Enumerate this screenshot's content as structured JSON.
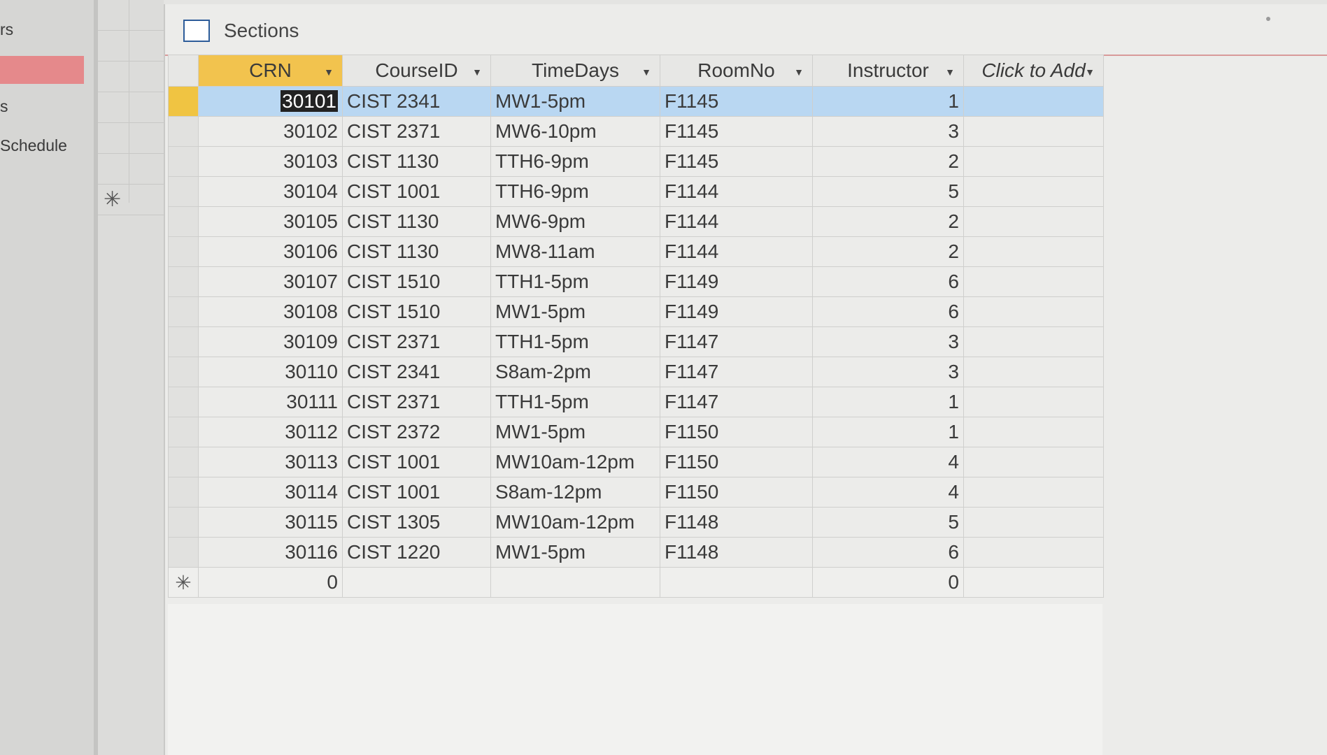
{
  "nav": {
    "items": [
      "rs",
      "",
      "s",
      "Schedule"
    ]
  },
  "window": {
    "title": "Sections"
  },
  "table": {
    "columns": [
      "CRN",
      "CourseID",
      "TimeDays",
      "RoomNo",
      "Instructor",
      "Click to Add"
    ],
    "rows": [
      {
        "crn": "30101",
        "course": "CIST 2341",
        "time": "MW1-5pm",
        "room": "F1145",
        "instructor": "1"
      },
      {
        "crn": "30102",
        "course": "CIST 2371",
        "time": "MW6-10pm",
        "room": "F1145",
        "instructor": "3"
      },
      {
        "crn": "30103",
        "course": "CIST 1130",
        "time": "TTH6-9pm",
        "room": "F1145",
        "instructor": "2"
      },
      {
        "crn": "30104",
        "course": "CIST 1001",
        "time": "TTH6-9pm",
        "room": "F1144",
        "instructor": "5"
      },
      {
        "crn": "30105",
        "course": "CIST 1130",
        "time": "MW6-9pm",
        "room": "F1144",
        "instructor": "2"
      },
      {
        "crn": "30106",
        "course": "CIST 1130",
        "time": "MW8-11am",
        "room": "F1144",
        "instructor": "2"
      },
      {
        "crn": "30107",
        "course": "CIST 1510",
        "time": "TTH1-5pm",
        "room": "F1149",
        "instructor": "6"
      },
      {
        "crn": "30108",
        "course": "CIST 1510",
        "time": "MW1-5pm",
        "room": "F1149",
        "instructor": "6"
      },
      {
        "crn": "30109",
        "course": "CIST 2371",
        "time": "TTH1-5pm",
        "room": "F1147",
        "instructor": "3"
      },
      {
        "crn": "30110",
        "course": "CIST 2341",
        "time": "S8am-2pm",
        "room": "F1147",
        "instructor": "3"
      },
      {
        "crn": "30111",
        "course": "CIST 2371",
        "time": "TTH1-5pm",
        "room": "F1147",
        "instructor": "1"
      },
      {
        "crn": "30112",
        "course": "CIST 2372",
        "time": "MW1-5pm",
        "room": "F1150",
        "instructor": "1"
      },
      {
        "crn": "30113",
        "course": "CIST 1001",
        "time": "MW10am-12pm",
        "room": "F1150",
        "instructor": "4"
      },
      {
        "crn": "30114",
        "course": "CIST 1001",
        "time": "S8am-12pm",
        "room": "F1150",
        "instructor": "4"
      },
      {
        "crn": "30115",
        "course": "CIST 1305",
        "time": "MW10am-12pm",
        "room": "F1148",
        "instructor": "5"
      },
      {
        "crn": "30116",
        "course": "CIST 1220",
        "time": "MW1-5pm",
        "room": "F1148",
        "instructor": "6"
      }
    ],
    "new_row": {
      "marker": "✳",
      "crn": "0",
      "instructor": "0"
    }
  },
  "colors": {
    "header_selected": "#f2c34e",
    "row_selected": "#b9d7f2",
    "nav_selected": "#e5898b"
  },
  "icons": {
    "table": "table-icon",
    "dropdown": "dropdown-arrow-icon"
  }
}
